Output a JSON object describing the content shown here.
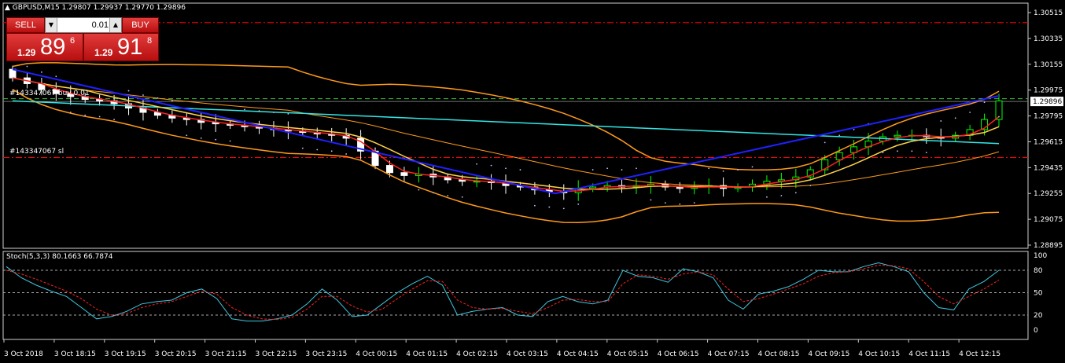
{
  "header": {
    "symbol_line": "GBPUSD,M15  1.29807 1.29937 1.29770 1.29896"
  },
  "trade_panel": {
    "sell_label": "SELL",
    "buy_label": "BUY",
    "lot_value": "0.01",
    "sell_price": {
      "small": "1.29",
      "big": "89",
      "sup": "6"
    },
    "buy_price": {
      "small": "1.29",
      "big": "91",
      "sup": "8"
    }
  },
  "orders": {
    "tp_label": "#143347067 buy 0.01",
    "sl_label": "#143347067 sl"
  },
  "price_axis": {
    "ticks": [
      "1.30515",
      "1.30335",
      "1.30155",
      "1.29975",
      "1.29795",
      "1.29615",
      "1.29435",
      "1.29255",
      "1.29075",
      "1.28895"
    ],
    "current_price": "1.29896"
  },
  "stochastic": {
    "label": "Stoch(5,3,3) 80.1663 66.7874",
    "ticks": [
      "100",
      "80",
      "50",
      "20",
      "0"
    ]
  },
  "time_axis": {
    "ticks": [
      "3 Oct 2018",
      "3 Oct 18:15",
      "3 Oct 19:15",
      "3 Oct 20:15",
      "3 Oct 21:15",
      "3 Oct 22:15",
      "3 Oct 23:15",
      "4 Oct 00:15",
      "4 Oct 01:15",
      "4 Oct 02:15",
      "4 Oct 03:15",
      "4 Oct 04:15",
      "4 Oct 05:15",
      "4 Oct 06:15",
      "4 Oct 07:15",
      "4 Oct 08:15",
      "4 Oct 09:15",
      "4 Oct 10:15",
      "4 Oct 11:15",
      "4 Oct 12:15"
    ]
  },
  "colors": {
    "background": "#000000",
    "bull_candle": "#00ff00",
    "bear_candle": "#ffffff",
    "ma_red": "#ff2020",
    "ma_yellow": "#ffd24a",
    "bollinger": "#ff9a1a",
    "slow_ma": "#33e6e6",
    "trendline": "#2020ff",
    "level_line": "#ff0000",
    "stoch_main": "#3fc8e0",
    "stoch_signal": "#ff2020"
  },
  "chart_data": {
    "type": "candlestick",
    "symbol": "GBPUSD",
    "timeframe": "M15",
    "ohlc_last": {
      "open": 1.29807,
      "high": 1.29937,
      "low": 1.2977,
      "close": 1.29896
    },
    "ylim": [
      1.28895,
      1.30515
    ],
    "order_levels": {
      "entry": 1.29915,
      "sl": 1.29505,
      "tp": 1.30445
    },
    "close_series": [
      1.3006,
      1.3002,
      1.2998,
      1.2995,
      1.2993,
      1.2991,
      1.299,
      1.2988,
      1.2985,
      1.2982,
      1.298,
      1.2978,
      1.2977,
      1.2975,
      1.2974,
      1.2973,
      1.2972,
      1.2971,
      1.297,
      1.2969,
      1.2968,
      1.2967,
      1.2966,
      1.2964,
      1.2955,
      1.2945,
      1.294,
      1.2938,
      1.2939,
      1.2937,
      1.2935,
      1.2934,
      1.2934,
      1.2933,
      1.2931,
      1.293,
      1.2928,
      1.2927,
      1.2926,
      1.2929,
      1.293,
      1.2931,
      1.293,
      1.2931,
      1.2932,
      1.293,
      1.2929,
      1.293,
      1.2931,
      1.2929,
      1.293,
      1.2932,
      1.2934,
      1.2935,
      1.2937,
      1.2942,
      1.2949,
      1.2954,
      1.2958,
      1.2962,
      1.2965,
      1.2966,
      1.2966,
      1.2965,
      1.2964,
      1.2966,
      1.297,
      1.2977,
      1.299
    ],
    "stoch_main": [
      85,
      70,
      60,
      52,
      45,
      30,
      15,
      18,
      25,
      35,
      38,
      40,
      50,
      55,
      42,
      15,
      12,
      12,
      15,
      20,
      35,
      55,
      40,
      18,
      20,
      35,
      50,
      62,
      72,
      60,
      20,
      25,
      28,
      30,
      20,
      18,
      38,
      45,
      38,
      35,
      40,
      80,
      72,
      70,
      64,
      82,
      78,
      70,
      40,
      28,
      48,
      52,
      58,
      68,
      80,
      78,
      78,
      85,
      90,
      85,
      78,
      50,
      30,
      27,
      55,
      65,
      80
    ],
    "stoch_signal": [
      80,
      75,
      68,
      60,
      52,
      42,
      28,
      20,
      22,
      30,
      35,
      38,
      45,
      52,
      48,
      30,
      20,
      15,
      14,
      17,
      28,
      45,
      45,
      32,
      24,
      28,
      42,
      55,
      66,
      65,
      40,
      30,
      28,
      29,
      25,
      22,
      30,
      40,
      41,
      38,
      38,
      62,
      74,
      72,
      68,
      75,
      78,
      74,
      55,
      38,
      42,
      48,
      55,
      62,
      72,
      77,
      78,
      82,
      87,
      86,
      82,
      65,
      45,
      35,
      45,
      55,
      67
    ]
  }
}
